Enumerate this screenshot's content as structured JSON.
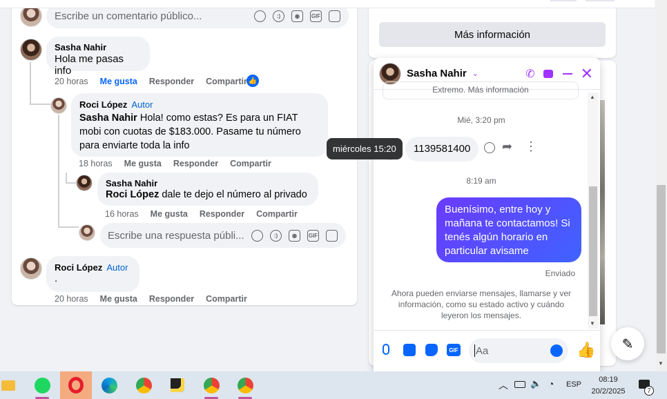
{
  "comments": {
    "top_input_placeholder": "Escribe un comentario público...",
    "c1": {
      "author": "Sasha Nahir",
      "text": "Hola me pasas info",
      "time": "20 horas",
      "like": "Me gusta",
      "reply": "Responder",
      "share": "Compartir"
    },
    "r1": {
      "author": "Roci López",
      "badge": "Autor",
      "mention": "Sasha Nahir",
      "text": " Hola! como estas? Es para un FIAT mobi con cuotas de $183.000. Pasame tu número para enviarte toda la info",
      "time": "18 horas",
      "like": "Me gusta",
      "reply": "Responder",
      "share": "Compartir"
    },
    "r2": {
      "author": "Sasha Nahir",
      "mention": "Roci López",
      "text": " dale te dejo el número al privado",
      "time": "16 horas",
      "like": "Me gusta",
      "reply": "Responder",
      "share": "Compartir"
    },
    "reply_input_placeholder": "Escribe una respuesta públi...",
    "c2": {
      "author": "Roci López",
      "badge": "Autor",
      "text": ".",
      "time": "20 horas",
      "like": "Me gusta",
      "reply": "Responder",
      "share": "Compartir"
    }
  },
  "side": {
    "more_info": "Más información"
  },
  "chat": {
    "contact_name": "Sasha Nahir",
    "cut_text": "Extremo. Más información",
    "day_label": "Mié, 3:20 pm",
    "tooltip": "miércoles 15:20",
    "incoming_msg": "1139581400",
    "time2": "8:19 am",
    "outgoing_msg": "Buenísimo, entre hoy y mañana te contactamos! Si tenés algún horario en particular avisame",
    "sent_status": "Enviado",
    "notice": "Ahora pueden enviarse mensajes, llamarse y ver información, como su estado activo y cuándo leyeron los mensajes.",
    "input_placeholder": "Aa"
  },
  "taskbar": {
    "lang": "ESP",
    "time": "08:19",
    "date": "20/2/2025",
    "notif_count": "7"
  },
  "colors": {
    "brand_blue": "#0866ff",
    "messenger_purple": "#a033ff",
    "bubble_gradient_start": "#6a3bff",
    "bubble_gradient_end": "#3f63ff"
  }
}
